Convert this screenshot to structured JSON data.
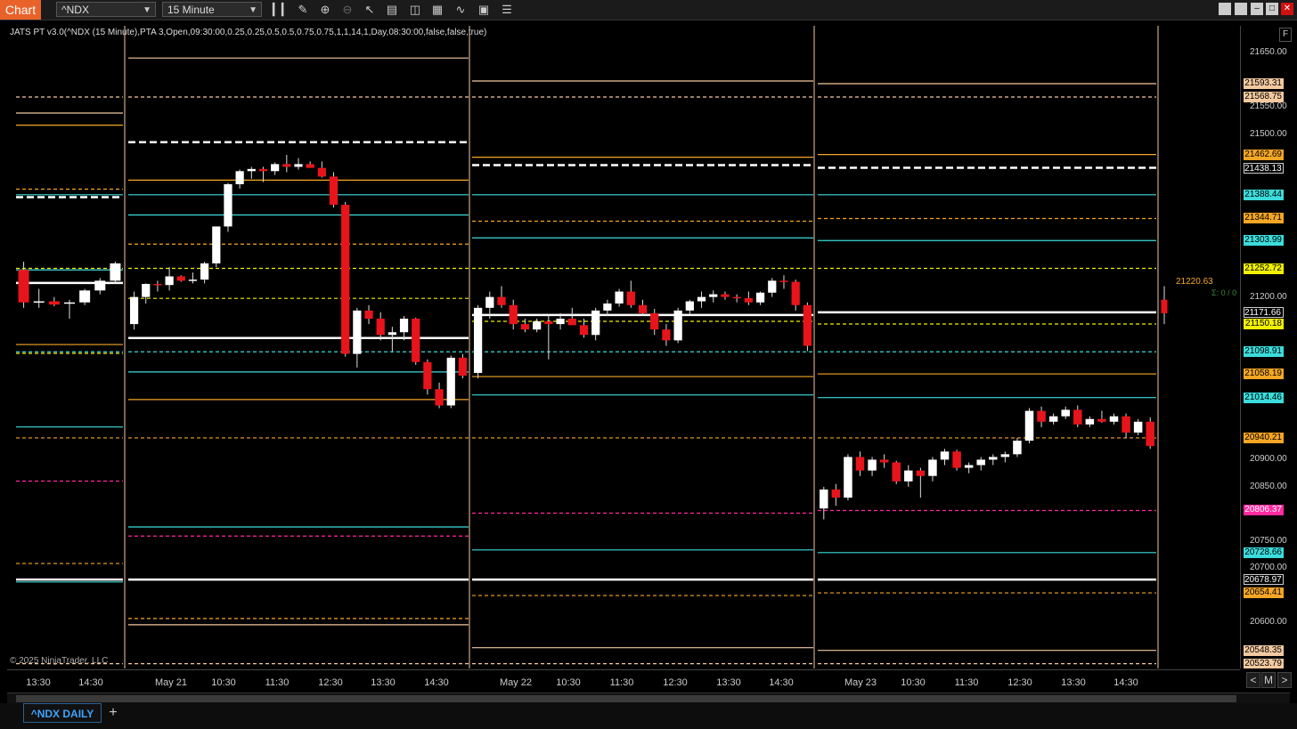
{
  "app": {
    "title": "Chart"
  },
  "toolbar": {
    "instrument": "^NDX",
    "interval": "15 Minute",
    "tools": [
      "bar-type-icon",
      "draw-icon",
      "zoom-in-icon",
      "zoom-out-icon",
      "pointer-icon",
      "properties-icon",
      "templates-icon",
      "strategies-icon",
      "indicators-icon",
      "data-box-icon",
      "more-icon"
    ]
  },
  "indicator_label": "JATS PT v3.0(^NDX (15 Minute),PTA 3,Open,09:30:00,0.25,0.25,0.5,0.5,0.75,0.75,1,1,14,1,Day,08:30:00,false,false,true)",
  "copyright": "© 2025 NinjaTrader, LLC",
  "colors": {
    "background": "#000000",
    "accent": "#e8622a",
    "up": "#ffffff",
    "down": "#e8141b",
    "orange": "#f5a623",
    "cyan": "#3cdcdc",
    "yellow": "#f0f000",
    "magenta": "#ff2aa0",
    "tan": "#f3c9a0"
  },
  "price_axis": {
    "ticks": [
      "21650.00",
      "21550.00",
      "21500.00",
      "21200.00",
      "20900.00",
      "20850.00",
      "20750.00",
      "20700.00",
      "20600.00"
    ],
    "tags": [
      {
        "text": "21593.31",
        "bg": "#f3c9a0",
        "fg": "#000"
      },
      {
        "text": "21568.75",
        "bg": "#f3c9a0",
        "fg": "#000"
      },
      {
        "text": "21462.69",
        "bg": "#f5a623",
        "fg": "#000"
      },
      {
        "text": "21438.13",
        "bg": "#000000",
        "fg": "#ffffff"
      },
      {
        "text": "21388.44",
        "bg": "#3cdcdc",
        "fg": "#000"
      },
      {
        "text": "21344.71",
        "bg": "#f5a623",
        "fg": "#000"
      },
      {
        "text": "21303.99",
        "bg": "#3cdcdc",
        "fg": "#000"
      },
      {
        "text": "21252.72",
        "bg": "#f0f000",
        "fg": "#000"
      },
      {
        "text": "21171.66",
        "bg": "#000000",
        "fg": "#ffffff"
      },
      {
        "text": "21150.18",
        "bg": "#f0f000",
        "fg": "#000"
      },
      {
        "text": "21098.91",
        "bg": "#3cdcdc",
        "fg": "#000"
      },
      {
        "text": "21058.19",
        "bg": "#f5a623",
        "fg": "#000"
      },
      {
        "text": "21014.46",
        "bg": "#3cdcdc",
        "fg": "#000"
      },
      {
        "text": "20940.21",
        "bg": "#f5a623",
        "fg": "#000"
      },
      {
        "text": "20806.37",
        "bg": "#ff2aa0",
        "fg": "#ffffff"
      },
      {
        "text": "20728.66",
        "bg": "#3cdcdc",
        "fg": "#000"
      },
      {
        "text": "20678.97",
        "bg": "#000000",
        "fg": "#ffffff"
      },
      {
        "text": "20654.41",
        "bg": "#f5a623",
        "fg": "#000"
      },
      {
        "text": "20548.35",
        "bg": "#f3c9a0",
        "fg": "#000"
      },
      {
        "text": "20523.79",
        "bg": "#f3c9a0",
        "fg": "#000"
      }
    ],
    "f_button": "F"
  },
  "last_price": "21220.63",
  "sigma_label": "Σ: 0 / 0",
  "time_axis": {
    "labels": [
      "13:30",
      "14:30",
      "May 21",
      "10:30",
      "11:30",
      "12:30",
      "13:30",
      "14:30",
      "May 22",
      "10:30",
      "11:30",
      "12:30",
      "13:30",
      "14:30",
      "May 23",
      "10:30",
      "11:30",
      "12:30",
      "13:30",
      "14:30"
    ]
  },
  "nav": {
    "prev": "<",
    "mode": "M",
    "next": ">"
  },
  "tabs": [
    {
      "label": "^NDX DAILY"
    }
  ],
  "tab_add": "+",
  "window_controls": [
    "restore-icon",
    "restore-icon",
    "minimize-icon",
    "maximize-icon",
    "close-icon"
  ],
  "chart_data": {
    "type": "candlestick",
    "instrument": "^NDX",
    "interval": "15 Minute",
    "ylim": [
      20515,
      21700
    ],
    "sessions": [
      {
        "label": "prior",
        "candles": [
          {
            "o": 21250,
            "h": 21265,
            "l": 21180,
            "c": 21190
          },
          {
            "o": 21190,
            "h": 21215,
            "l": 21180,
            "c": 21192
          },
          {
            "o": 21192,
            "h": 21200,
            "l": 21183,
            "c": 21186
          },
          {
            "o": 21188,
            "h": 21195,
            "l": 21160,
            "c": 21190
          },
          {
            "o": 21190,
            "h": 21215,
            "l": 21185,
            "c": 21212
          },
          {
            "o": 21212,
            "h": 21235,
            "l": 21205,
            "c": 21230
          },
          {
            "o": 21230,
            "h": 21265,
            "l": 21225,
            "c": 21262
          }
        ]
      },
      {
        "label": "May 21",
        "candles": [
          {
            "o": 21150,
            "h": 21210,
            "l": 21140,
            "c": 21200
          },
          {
            "o": 21200,
            "h": 21225,
            "l": 21188,
            "c": 21224
          },
          {
            "o": 21224,
            "h": 21230,
            "l": 21210,
            "c": 21222
          },
          {
            "o": 21222,
            "h": 21255,
            "l": 21212,
            "c": 21238
          },
          {
            "o": 21238,
            "h": 21240,
            "l": 21228,
            "c": 21230
          },
          {
            "o": 21230,
            "h": 21245,
            "l": 21225,
            "c": 21232
          },
          {
            "o": 21232,
            "h": 21265,
            "l": 21225,
            "c": 21262
          },
          {
            "o": 21262,
            "h": 21330,
            "l": 21255,
            "c": 21330
          },
          {
            "o": 21330,
            "h": 21410,
            "l": 21320,
            "c": 21408
          },
          {
            "o": 21408,
            "h": 21435,
            "l": 21400,
            "c": 21432
          },
          {
            "o": 21432,
            "h": 21440,
            "l": 21418,
            "c": 21436
          },
          {
            "o": 21436,
            "h": 21440,
            "l": 21412,
            "c": 21432
          },
          {
            "o": 21432,
            "h": 21448,
            "l": 21425,
            "c": 21445
          },
          {
            "o": 21445,
            "h": 21462,
            "l": 21430,
            "c": 21440
          },
          {
            "o": 21440,
            "h": 21456,
            "l": 21435,
            "c": 21445
          },
          {
            "o": 21445,
            "h": 21450,
            "l": 21440,
            "c": 21438
          },
          {
            "o": 21438,
            "h": 21450,
            "l": 21420,
            "c": 21422
          },
          {
            "o": 21422,
            "h": 21430,
            "l": 21365,
            "c": 21370
          },
          {
            "o": 21370,
            "h": 21375,
            "l": 21090,
            "c": 21095
          },
          {
            "o": 21095,
            "h": 21180,
            "l": 21070,
            "c": 21175
          },
          {
            "o": 21175,
            "h": 21185,
            "l": 21150,
            "c": 21160
          },
          {
            "o": 21160,
            "h": 21172,
            "l": 21120,
            "c": 21130
          },
          {
            "o": 21130,
            "h": 21145,
            "l": 21100,
            "c": 21135
          },
          {
            "o": 21135,
            "h": 21165,
            "l": 21120,
            "c": 21160
          },
          {
            "o": 21160,
            "h": 21162,
            "l": 21075,
            "c": 21080
          },
          {
            "o": 21080,
            "h": 21085,
            "l": 21020,
            "c": 21030
          },
          {
            "o": 21030,
            "h": 21042,
            "l": 20995,
            "c": 21000
          },
          {
            "o": 21000,
            "h": 21092,
            "l": 20995,
            "c": 21088
          },
          {
            "o": 21088,
            "h": 21095,
            "l": 21050,
            "c": 21055
          }
        ]
      },
      {
        "label": "May 22",
        "candles": [
          {
            "o": 21060,
            "h": 21185,
            "l": 21050,
            "c": 21180
          },
          {
            "o": 21180,
            "h": 21210,
            "l": 21160,
            "c": 21200
          },
          {
            "o": 21200,
            "h": 21220,
            "l": 21180,
            "c": 21185
          },
          {
            "o": 21185,
            "h": 21195,
            "l": 21140,
            "c": 21150
          },
          {
            "o": 21150,
            "h": 21160,
            "l": 21135,
            "c": 21140
          },
          {
            "o": 21140,
            "h": 21160,
            "l": 21135,
            "c": 21155
          },
          {
            "o": 21155,
            "h": 21165,
            "l": 21085,
            "c": 21150
          },
          {
            "o": 21150,
            "h": 21170,
            "l": 21140,
            "c": 21160
          },
          {
            "o": 21160,
            "h": 21180,
            "l": 21150,
            "c": 21148
          },
          {
            "o": 21148,
            "h": 21160,
            "l": 21125,
            "c": 21130
          },
          {
            "o": 21130,
            "h": 21180,
            "l": 21120,
            "c": 21175
          },
          {
            "o": 21175,
            "h": 21195,
            "l": 21165,
            "c": 21188
          },
          {
            "o": 21188,
            "h": 21215,
            "l": 21182,
            "c": 21210
          },
          {
            "o": 21210,
            "h": 21230,
            "l": 21180,
            "c": 21185
          },
          {
            "o": 21185,
            "h": 21195,
            "l": 21165,
            "c": 21170
          },
          {
            "o": 21170,
            "h": 21178,
            "l": 21130,
            "c": 21140
          },
          {
            "o": 21140,
            "h": 21150,
            "l": 21110,
            "c": 21120
          },
          {
            "o": 21120,
            "h": 21180,
            "l": 21115,
            "c": 21175
          },
          {
            "o": 21175,
            "h": 21195,
            "l": 21168,
            "c": 21192
          },
          {
            "o": 21192,
            "h": 21210,
            "l": 21180,
            "c": 21200
          },
          {
            "o": 21200,
            "h": 21212,
            "l": 21190,
            "c": 21205
          },
          {
            "o": 21205,
            "h": 21210,
            "l": 21195,
            "c": 21200
          },
          {
            "o": 21200,
            "h": 21205,
            "l": 21190,
            "c": 21198
          },
          {
            "o": 21198,
            "h": 21210,
            "l": 21185,
            "c": 21190
          },
          {
            "o": 21190,
            "h": 21210,
            "l": 21185,
            "c": 21208
          },
          {
            "o": 21208,
            "h": 21235,
            "l": 21200,
            "c": 21230
          },
          {
            "o": 21230,
            "h": 21240,
            "l": 21215,
            "c": 21228
          },
          {
            "o": 21228,
            "h": 21232,
            "l": 21175,
            "c": 21185
          },
          {
            "o": 21185,
            "h": 21190,
            "l": 21100,
            "c": 21110
          }
        ]
      },
      {
        "label": "May 23",
        "candles": [
          {
            "o": 20810,
            "h": 20850,
            "l": 20790,
            "c": 20845
          },
          {
            "o": 20845,
            "h": 20855,
            "l": 20815,
            "c": 20830
          },
          {
            "o": 20830,
            "h": 20910,
            "l": 20825,
            "c": 20905
          },
          {
            "o": 20905,
            "h": 20915,
            "l": 20870,
            "c": 20880
          },
          {
            "o": 20880,
            "h": 20905,
            "l": 20870,
            "c": 20900
          },
          {
            "o": 20900,
            "h": 20910,
            "l": 20885,
            "c": 20895
          },
          {
            "o": 20895,
            "h": 20898,
            "l": 20855,
            "c": 20860
          },
          {
            "o": 20860,
            "h": 20890,
            "l": 20850,
            "c": 20880
          },
          {
            "o": 20880,
            "h": 20885,
            "l": 20830,
            "c": 20870
          },
          {
            "o": 20870,
            "h": 20905,
            "l": 20860,
            "c": 20900
          },
          {
            "o": 20900,
            "h": 20920,
            "l": 20890,
            "c": 20915
          },
          {
            "o": 20915,
            "h": 20918,
            "l": 20880,
            "c": 20885
          },
          {
            "o": 20885,
            "h": 20895,
            "l": 20875,
            "c": 20890
          },
          {
            "o": 20890,
            "h": 20905,
            "l": 20880,
            "c": 20900
          },
          {
            "o": 20900,
            "h": 20910,
            "l": 20890,
            "c": 20905
          },
          {
            "o": 20905,
            "h": 20915,
            "l": 20895,
            "c": 20910
          },
          {
            "o": 20910,
            "h": 20940,
            "l": 20905,
            "c": 20935
          },
          {
            "o": 20935,
            "h": 20995,
            "l": 20930,
            "c": 20990
          },
          {
            "o": 20990,
            "h": 20998,
            "l": 20960,
            "c": 20970
          },
          {
            "o": 20970,
            "h": 20985,
            "l": 20965,
            "c": 20980
          },
          {
            "o": 20980,
            "h": 20998,
            "l": 20975,
            "c": 20992
          },
          {
            "o": 20992,
            "h": 21000,
            "l": 20960,
            "c": 20965
          },
          {
            "o": 20965,
            "h": 20980,
            "l": 20960,
            "c": 20975
          },
          {
            "o": 20975,
            "h": 20990,
            "l": 20968,
            "c": 20970
          },
          {
            "o": 20970,
            "h": 20985,
            "l": 20965,
            "c": 20980
          },
          {
            "o": 20980,
            "h": 20985,
            "l": 20940,
            "c": 20950
          },
          {
            "o": 20950,
            "h": 20975,
            "l": 20945,
            "c": 20970
          },
          {
            "o": 20970,
            "h": 20978,
            "l": 20920,
            "c": 20925
          }
        ]
      },
      {
        "label": "current",
        "candles": [
          {
            "o": 21195,
            "h": 21220,
            "l": 21150,
            "c": 21170
          }
        ]
      }
    ],
    "levels": [
      {
        "price": 21593.31,
        "color": "#f3c9a0",
        "style": "solid"
      },
      {
        "price": 21568.75,
        "color": "#f3c9a0",
        "style": "dashed"
      },
      {
        "price": 21462.69,
        "color": "#f5a623",
        "style": "solid"
      },
      {
        "price": 21438.13,
        "color": "#ffffff",
        "style": "dashed"
      },
      {
        "price": 21388.44,
        "color": "#3cdcdc",
        "style": "solid"
      },
      {
        "price": 21344.71,
        "color": "#f5a623",
        "style": "dashed"
      },
      {
        "price": 21303.99,
        "color": "#3cdcdc",
        "style": "solid"
      },
      {
        "price": 21252.72,
        "color": "#f0f000",
        "style": "dashed"
      },
      {
        "price": 21171.66,
        "color": "#ffffff",
        "style": "solid"
      },
      {
        "price": 21150.18,
        "color": "#f0f000",
        "style": "dashed"
      },
      {
        "price": 21098.91,
        "color": "#3cdcdc",
        "style": "dashed"
      },
      {
        "price": 21058.19,
        "color": "#f5a623",
        "style": "solid"
      },
      {
        "price": 21014.46,
        "color": "#3cdcdc",
        "style": "solid"
      },
      {
        "price": 20940.21,
        "color": "#f5a623",
        "style": "dashed"
      },
      {
        "price": 20806.37,
        "color": "#ff2aa0",
        "style": "dashed"
      },
      {
        "price": 20728.66,
        "color": "#3cdcdc",
        "style": "solid"
      },
      {
        "price": 20678.97,
        "color": "#ffffff",
        "style": "solid"
      },
      {
        "price": 20654.41,
        "color": "#f5a623",
        "style": "dashed"
      },
      {
        "price": 20548.35,
        "color": "#f3c9a0",
        "style": "solid"
      },
      {
        "price": 20523.79,
        "color": "#f3c9a0",
        "style": "dashed"
      }
    ]
  }
}
